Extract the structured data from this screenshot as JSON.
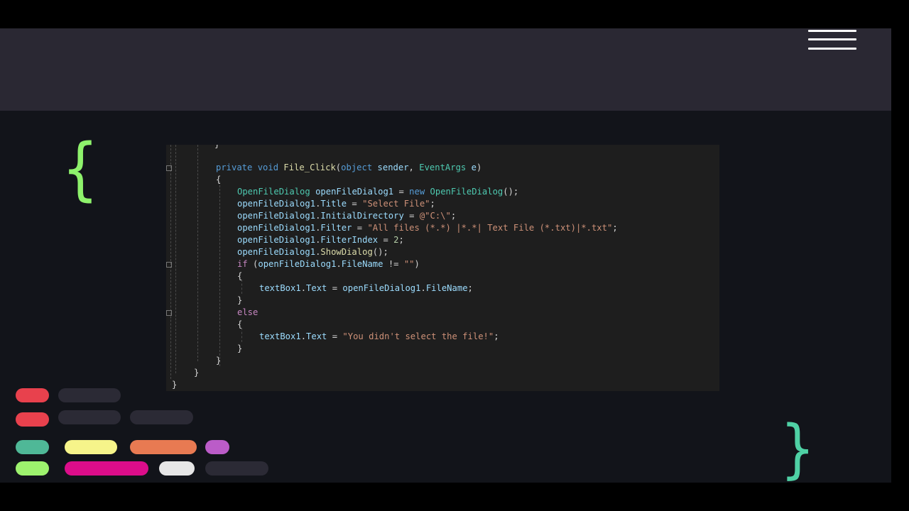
{
  "code_lines": [
    "}",
    "private void File_Click(object sender, EventArgs e)",
    "{",
    "OpenFileDialog openFileDialog1 = new OpenFileDialog();",
    "openFileDialog1.Title = \"Select File\";",
    "openFileDialog1.InitialDirectory = @\"C:\\\";",
    "openFileDialog1.Filter = \"All files (*.*) |*.*| Text File (*.txt)|*.txt\";",
    "openFileDialog1.FilterIndex = 2;",
    "openFileDialog1.ShowDialog();",
    "if (openFileDialog1.FileName != \"\")",
    "{",
    "textBox1.Text = openFileDialog1.FileName;",
    "}",
    "else",
    "{",
    "textBox1.Text = \"You didn't select the file!\";",
    "}",
    "}",
    "}",
    "}"
  ],
  "braces": {
    "left": "{",
    "right": "}"
  },
  "icons": {
    "menu": "hamburger-menu-icon"
  },
  "colors": {
    "background": "#12141a",
    "header": "#2a2833",
    "editor": "#1e1e1e",
    "left_brace": "#8ef26c",
    "right_brace": "#4fd1a5"
  },
  "pills": [
    {
      "color": "#e8414d"
    },
    {
      "color": "#2b2a35"
    },
    {
      "color": "#e8414d"
    },
    {
      "color": "#2b2a35"
    },
    {
      "color": "#2b2a35"
    },
    {
      "color": "#4fb897"
    },
    {
      "color": "#f6f48a"
    },
    {
      "color": "#e87a52"
    },
    {
      "color": "#bb5cc8"
    },
    {
      "color": "#9df26e"
    },
    {
      "color": "#dc0d8a"
    },
    {
      "color": "#e6e6e6"
    },
    {
      "color": "#2b2a35"
    }
  ]
}
